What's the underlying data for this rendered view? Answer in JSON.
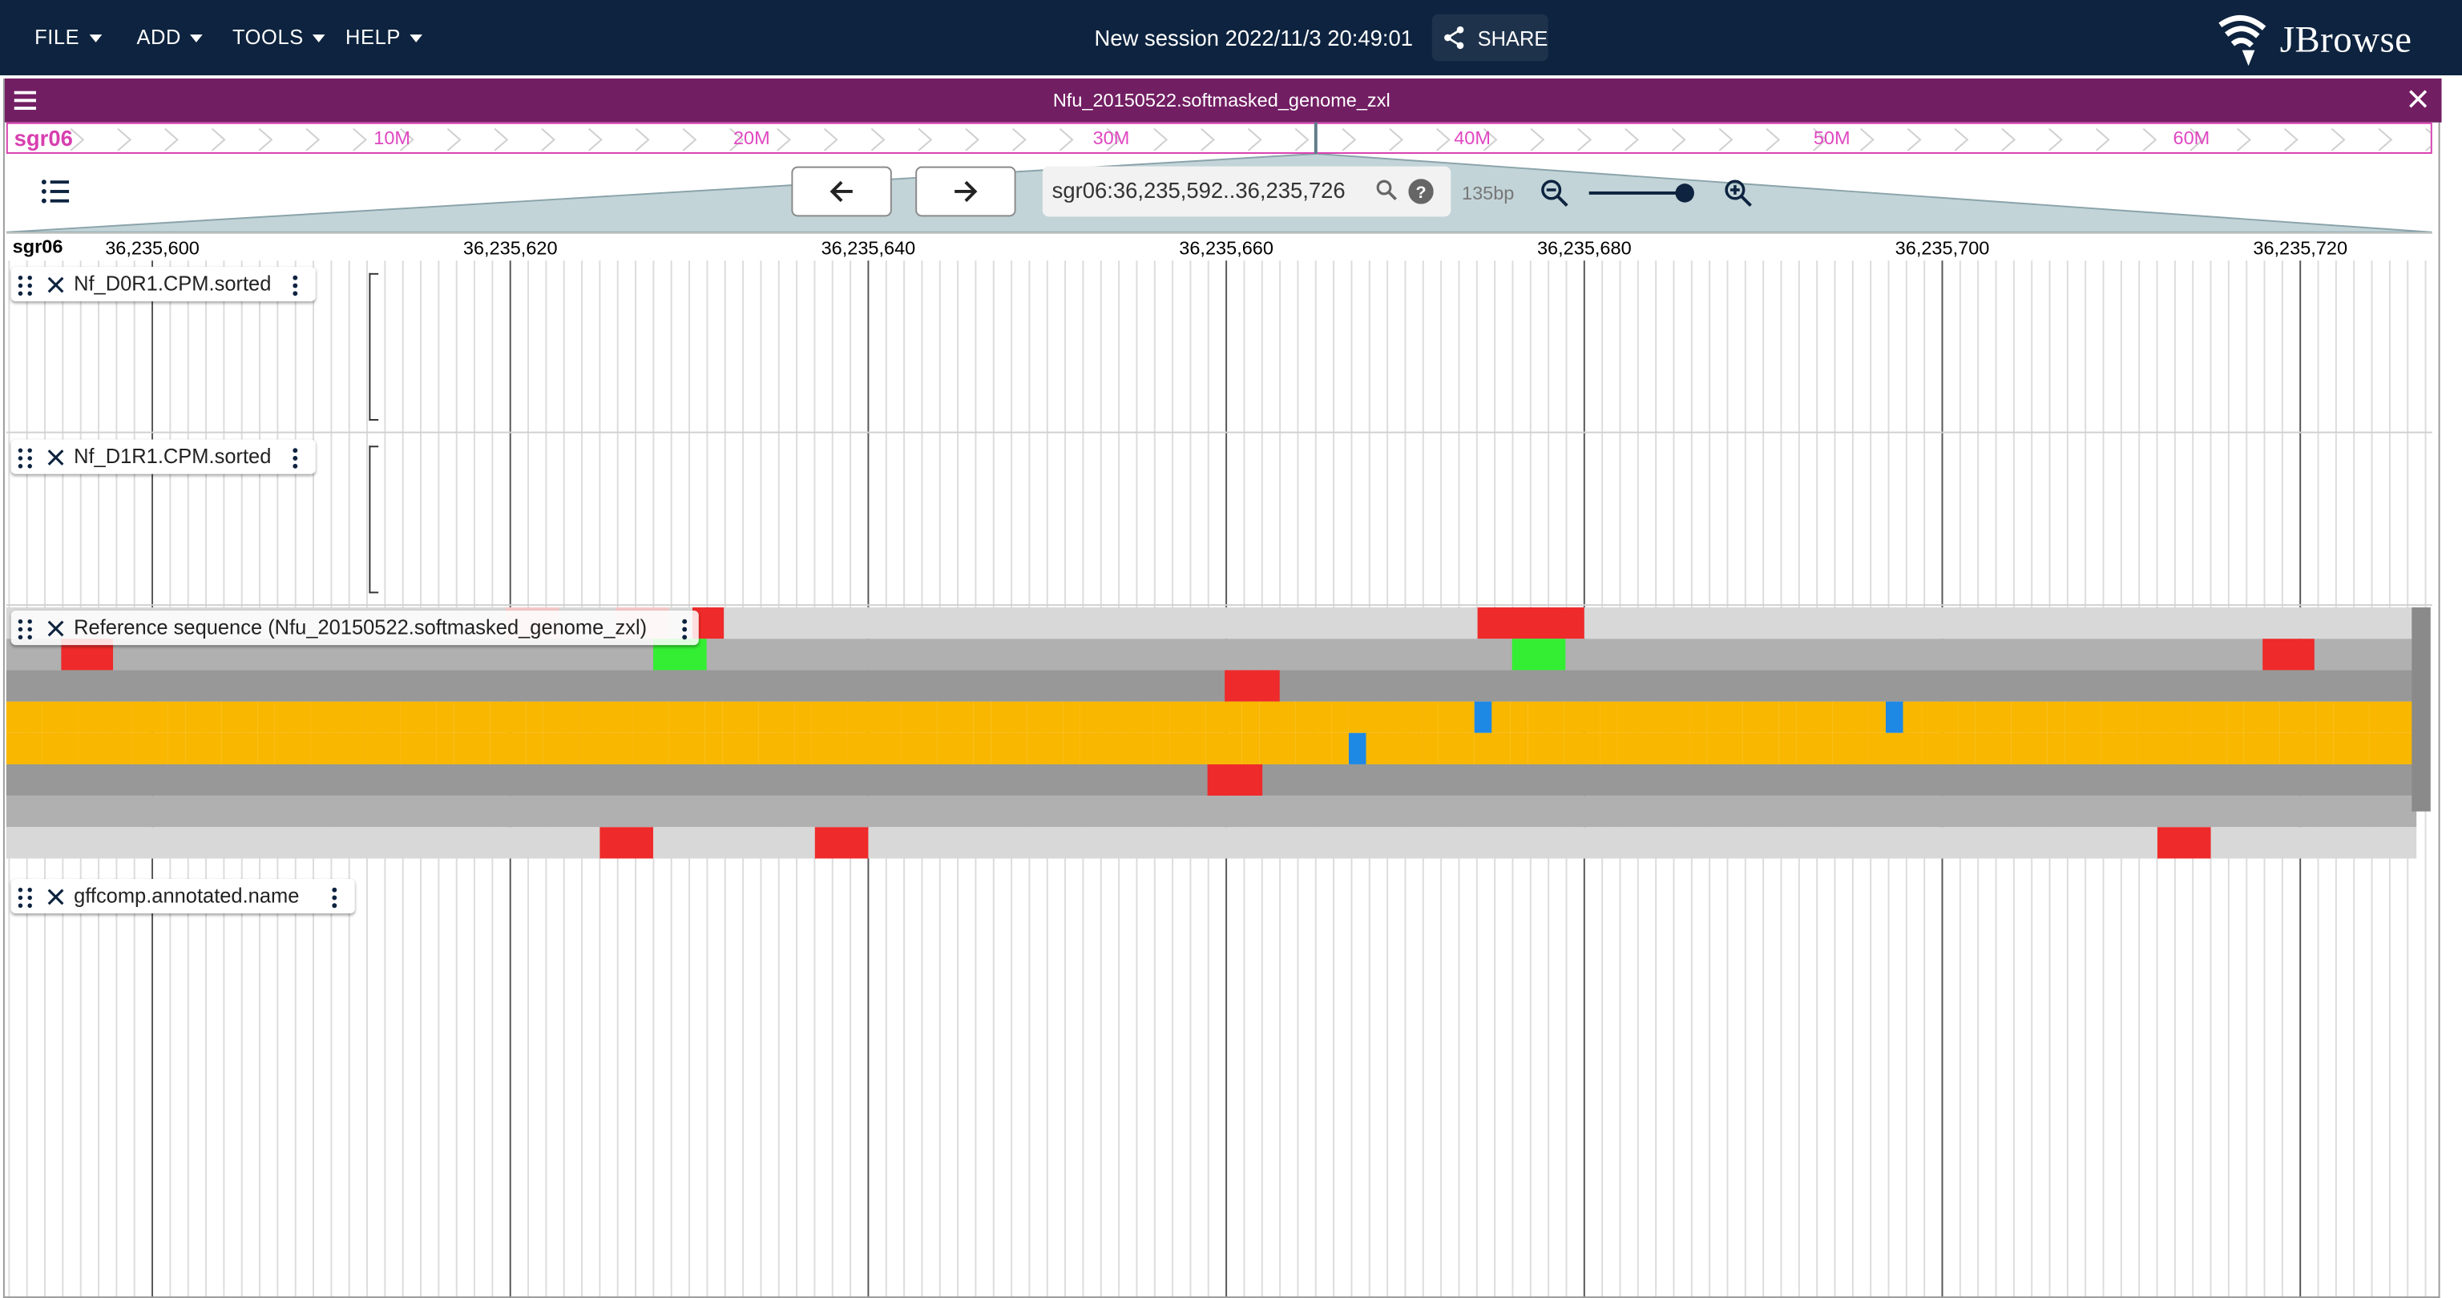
{
  "topbar": {
    "menus": [
      "FILE",
      "ADD",
      "TOOLS",
      "HELP"
    ],
    "session_title": "New session 2022/11/3 20:49:01",
    "share_label": "SHARE",
    "logo_text": "JBrowse"
  },
  "view": {
    "title": "Nfu_20150522.softmasked_genome_zxl",
    "overview": {
      "chrom": "sgr06",
      "ticks": [
        "10M",
        "20M",
        "30M",
        "40M",
        "50M",
        "60M"
      ]
    },
    "location": "sgr06:36,235,592..36,235,726",
    "bp_count": "135bp",
    "zoom_level_fraction": 0.93,
    "ruler": {
      "chrom": "sgr06",
      "labels": [
        "36,235,600",
        "36,235,620",
        "36,235,640",
        "36,235,660",
        "36,235,680",
        "36,235,700",
        "36,235,720"
      ]
    }
  },
  "tracks": [
    {
      "name": "Nf_D0R1.CPM.sorted"
    },
    {
      "name": "Nf_D1R1.CPM.sorted"
    },
    {
      "name": "Reference sequence (Nfu_20150522.softmasked_genome_zxl)"
    },
    {
      "name": "gffcomp.annotated.name"
    }
  ],
  "colors": {
    "topbar": "#0d233f",
    "view_header": "#721e63",
    "overview_accent": "#d83fb0",
    "base_A": "#6dbf4b",
    "base_C": "#1e88e5",
    "base_G": "#f9b700",
    "base_T": "#e53935",
    "stop_codon": "#ee2a2a",
    "start_codon": "#33ee33"
  }
}
